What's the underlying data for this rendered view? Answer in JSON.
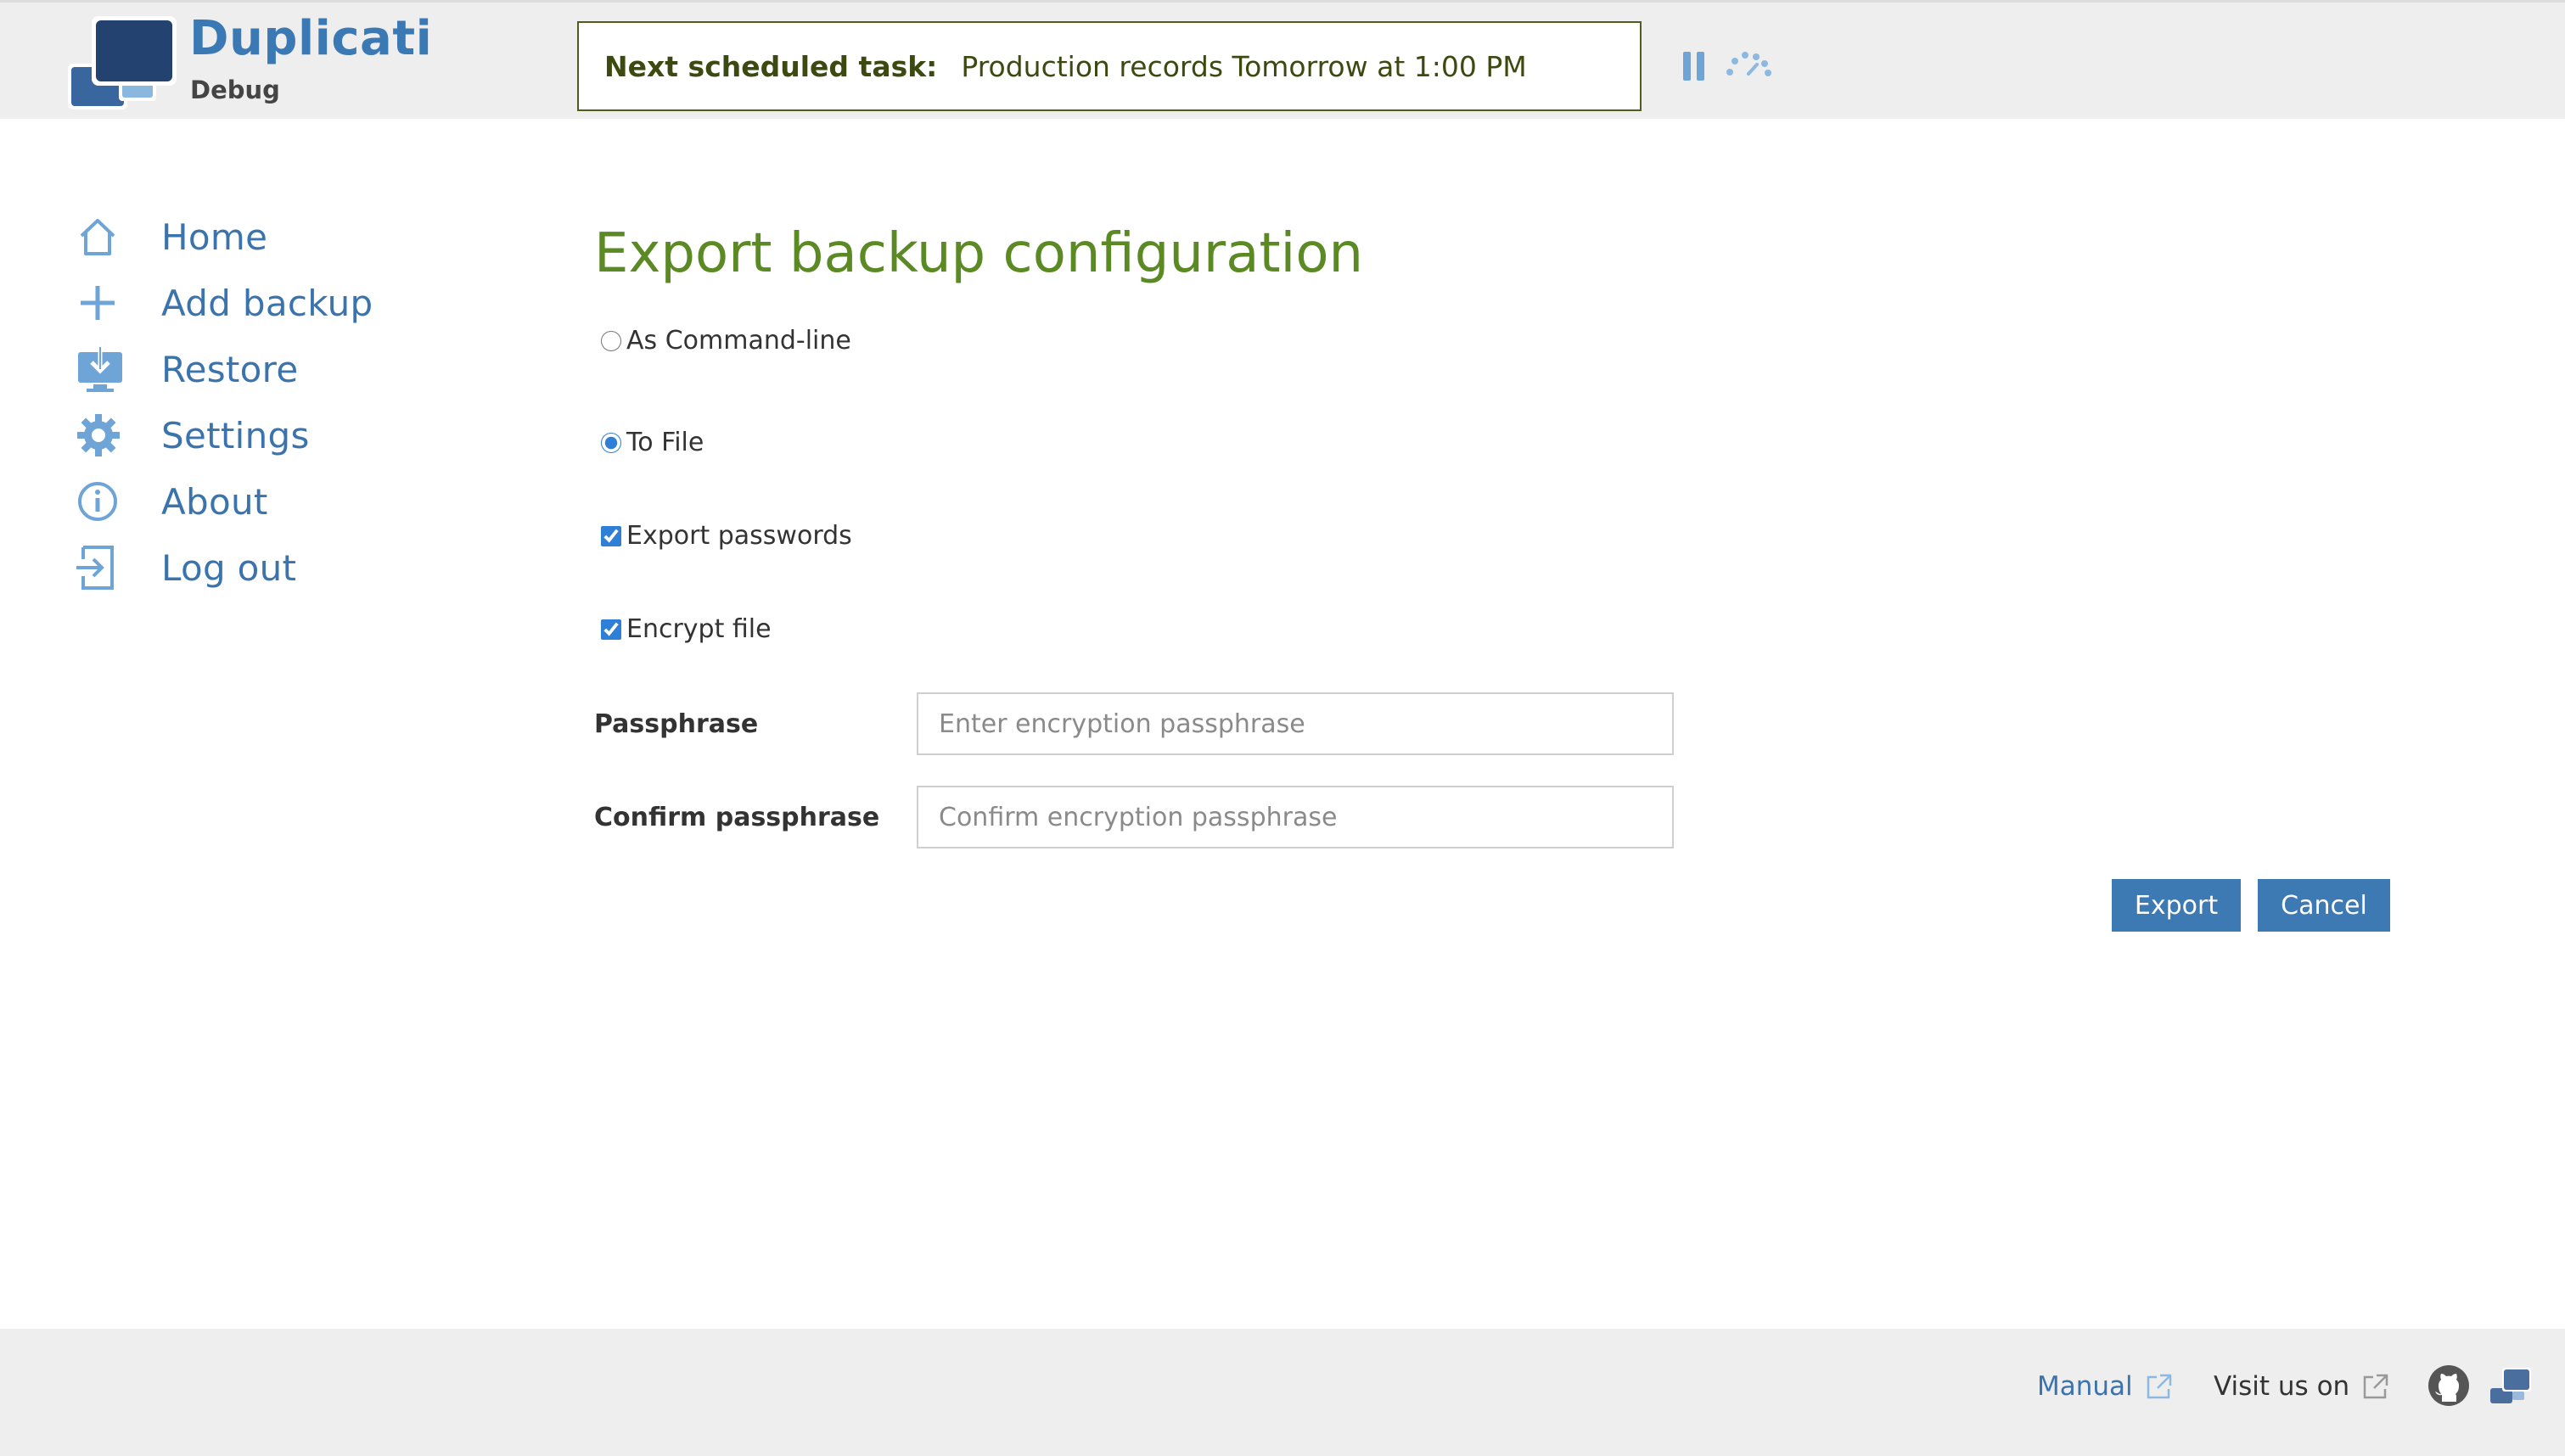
{
  "app": {
    "name": "Duplicati",
    "subtitle": "Debug"
  },
  "header": {
    "task_label": "Next scheduled task:",
    "task_value": "Production records Tomorrow at 1:00 PM",
    "pause_icon": "pause-icon",
    "throttle_icon": "speed-gauge-icon"
  },
  "sidebar": {
    "items": [
      {
        "label": "Home",
        "icon": "home-icon"
      },
      {
        "label": "Add backup",
        "icon": "plus-icon"
      },
      {
        "label": "Restore",
        "icon": "restore-icon"
      },
      {
        "label": "Settings",
        "icon": "gear-icon"
      },
      {
        "label": "About",
        "icon": "info-icon"
      },
      {
        "label": "Log out",
        "icon": "logout-icon"
      }
    ]
  },
  "main": {
    "title": "Export backup configuration",
    "export_mode": {
      "options": [
        "As Command-line",
        "To File"
      ],
      "selected": "To File"
    },
    "export_passwords": {
      "label": "Export passwords",
      "checked": true
    },
    "encrypt_file": {
      "label": "Encrypt file",
      "checked": true
    },
    "passphrase": {
      "label": "Passphrase",
      "placeholder": "Enter encryption passphrase",
      "value": ""
    },
    "confirm_passphrase": {
      "label": "Confirm passphrase",
      "placeholder": "Confirm encryption passphrase",
      "value": ""
    },
    "export_button": "Export",
    "cancel_button": "Cancel"
  },
  "footer": {
    "manual_link": "Manual",
    "visit_label": "Visit us on",
    "icons": [
      "external-link-icon",
      "github-icon",
      "duplicati-logo-icon"
    ]
  },
  "colors": {
    "accent": "#3d79b3",
    "title_green": "#5b8a25",
    "task_border": "#4f5e1e",
    "header_bg": "#eeeeee"
  }
}
